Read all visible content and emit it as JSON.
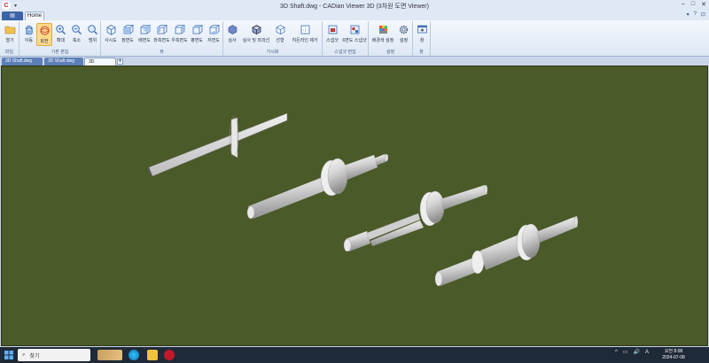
{
  "titlebar": {
    "title": "3D Shaft.dwg - CADian Viewer 3D (3차원 도면 Viewer)",
    "app_logo": "C",
    "quick_access": "▾",
    "minimize": "–",
    "maximize": "□",
    "close": "✕"
  },
  "tabs": {
    "app_menu": "▤",
    "home": "Home",
    "right_icons": [
      "▾",
      "?",
      "⊡"
    ]
  },
  "ribbon": {
    "groups": [
      {
        "label": "파일",
        "buttons": [
          {
            "label": "열기",
            "icon": "folder-icon"
          }
        ]
      },
      {
        "label": "기본 편집",
        "buttons": [
          {
            "label": "이동",
            "icon": "pan-hand-icon"
          },
          {
            "label": "회전",
            "icon": "orbit-icon"
          },
          {
            "label": "확대",
            "icon": "zoom-in-icon"
          },
          {
            "label": "축소",
            "icon": "zoom-out-icon"
          },
          {
            "label": "범위",
            "icon": "zoom-extents-icon"
          }
        ]
      },
      {
        "label": "뷰",
        "buttons": [
          {
            "label": "사시도",
            "icon": "iso-cube-icon"
          },
          {
            "label": "정면도",
            "icon": "front-cube-icon"
          },
          {
            "label": "배면도",
            "icon": "back-cube-icon"
          },
          {
            "label": "좌측면도",
            "icon": "left-cube-icon"
          },
          {
            "label": "우측면도",
            "icon": "right-cube-icon"
          },
          {
            "label": "평면도",
            "icon": "top-cube-icon"
          },
          {
            "label": "저면도",
            "icon": "bottom-cube-icon"
          }
        ]
      },
      {
        "label": "가시화",
        "buttons": [
          {
            "label": "실사",
            "icon": "realistic-icon"
          },
          {
            "label": "실사 및 외곽선",
            "icon": "realistic-edges-icon"
          },
          {
            "label": "선형",
            "icon": "wireframe-icon"
          },
          {
            "label": "히든라인 제거",
            "icon": "hidden-line-icon"
          }
        ]
      },
      {
        "label": "스냅샷 편집",
        "buttons": [
          {
            "label": "스냅샷",
            "icon": "snapshot-icon"
          },
          {
            "label": "6면도 스냅샷",
            "icon": "six-view-snapshot-icon"
          }
        ]
      },
      {
        "label": "설정",
        "buttons": [
          {
            "label": "배경색 설정",
            "icon": "palette-icon"
          },
          {
            "label": "설정",
            "icon": "gear-icon"
          }
        ]
      },
      {
        "label": "창",
        "buttons": [
          {
            "label": "창",
            "icon": "window-icon"
          }
        ]
      }
    ]
  },
  "doc_tabs": {
    "items": [
      {
        "label": "3D Shaft.dwg",
        "active": false
      },
      {
        "label": "3D Shaft.dwg",
        "active": false
      },
      {
        "label": "3D Shaft.dwg",
        "active": true
      }
    ],
    "add": "▾"
  },
  "viewport": {
    "background": "#4a5a28",
    "objects": [
      "keyed-shaft",
      "collar-shaft",
      "stepped-keyway-shaft",
      "bearing-shaft"
    ]
  },
  "taskbar": {
    "search_placeholder": "찾기",
    "tray": [
      "^",
      "▭",
      "🔊",
      "A"
    ],
    "time": "오전 8:08",
    "date": "2024-07-08"
  }
}
